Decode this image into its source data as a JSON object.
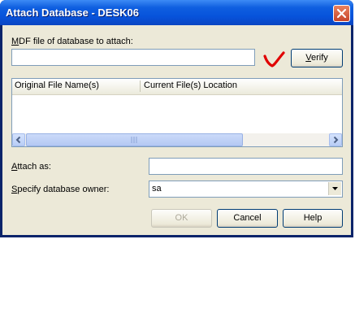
{
  "window": {
    "title": "Attach Database - DESK06"
  },
  "mdf": {
    "label_key": "M",
    "label_rest": "DF file of database to attach:",
    "value": "",
    "verify_key": "V",
    "verify_rest": "erify"
  },
  "files_list": {
    "columns": [
      "Original File Name(s)",
      "Current File(s) Location"
    ],
    "rows": []
  },
  "attach_as": {
    "label_key": "A",
    "label_rest": "ttach as:",
    "value": ""
  },
  "owner": {
    "label_key": "S",
    "label_rest": "pecify database owner:",
    "value": "sa"
  },
  "buttons": {
    "ok": "OK",
    "cancel": "Cancel",
    "help": "Help"
  },
  "colors": {
    "titlebar": "#0753db",
    "dialog_face": "#ece9d8",
    "close_button": "#c8452a",
    "annotation_mark": "#e00000"
  },
  "icons": {
    "close": "x-close-icon",
    "scroll_left": "chevron-left-icon",
    "scroll_right": "chevron-right-icon",
    "dropdown": "chevron-down-icon",
    "annotation": "red-check-annotation"
  }
}
